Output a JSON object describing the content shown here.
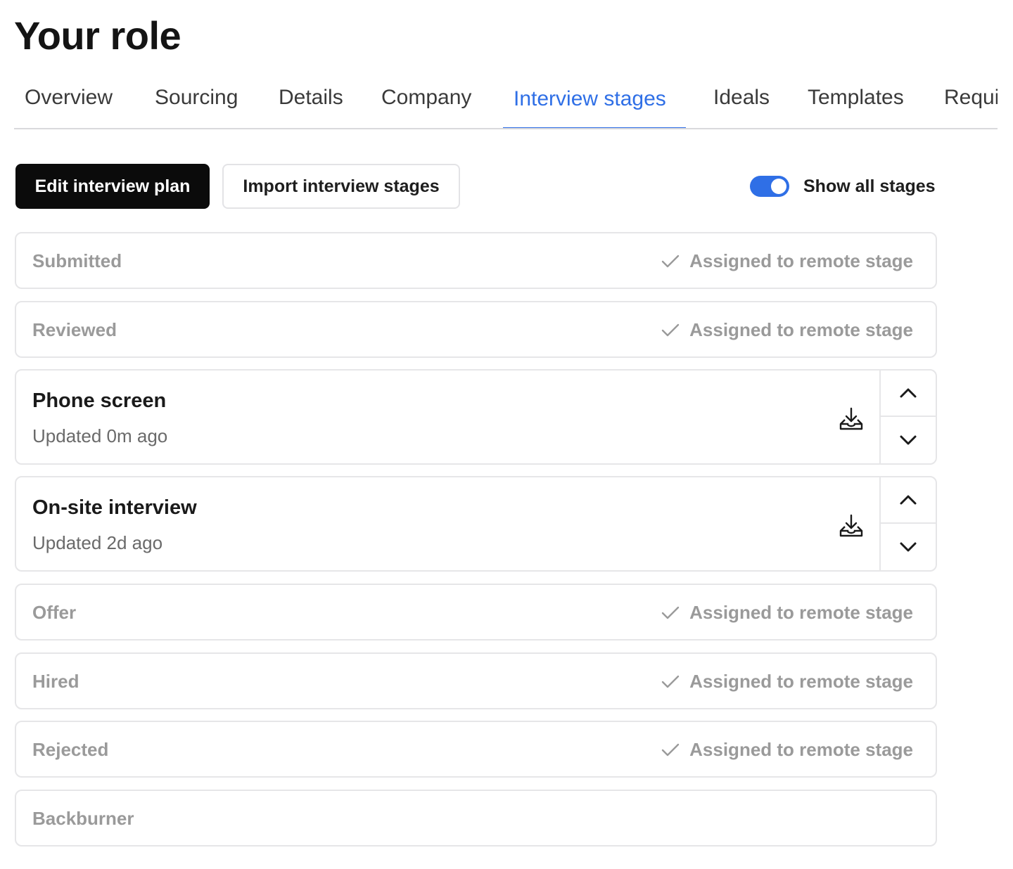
{
  "page": {
    "title": "Your role"
  },
  "tabs": [
    {
      "label": "Overview",
      "active": false
    },
    {
      "label": "Sourcing",
      "active": false
    },
    {
      "label": "Details",
      "active": false
    },
    {
      "label": "Company",
      "active": false
    },
    {
      "label": "Interview stages",
      "active": true
    },
    {
      "label": "Ideals",
      "active": false
    },
    {
      "label": "Templates",
      "active": false
    },
    {
      "label": "Requi",
      "active": false
    }
  ],
  "actions": {
    "edit_label": "Edit interview plan",
    "import_label": "Import interview stages",
    "toggle_label": "Show all stages",
    "toggle_on": true
  },
  "colors": {
    "accent": "#2f6fe6",
    "primary_button": "#0b0b0b"
  },
  "stages": [
    {
      "name": "Submitted",
      "status": "Assigned to remote stage"
    },
    {
      "name": "Reviewed",
      "status": "Assigned to remote stage"
    },
    {
      "name": "Phone screen",
      "updated": "Updated 0m ago"
    },
    {
      "name": "On-site interview",
      "updated": "Updated 2d ago"
    },
    {
      "name": "Offer",
      "status": "Assigned to remote stage"
    },
    {
      "name": "Hired",
      "status": "Assigned to remote stage"
    },
    {
      "name": "Rejected",
      "status": "Assigned to remote stage"
    },
    {
      "name": "Backburner"
    }
  ]
}
